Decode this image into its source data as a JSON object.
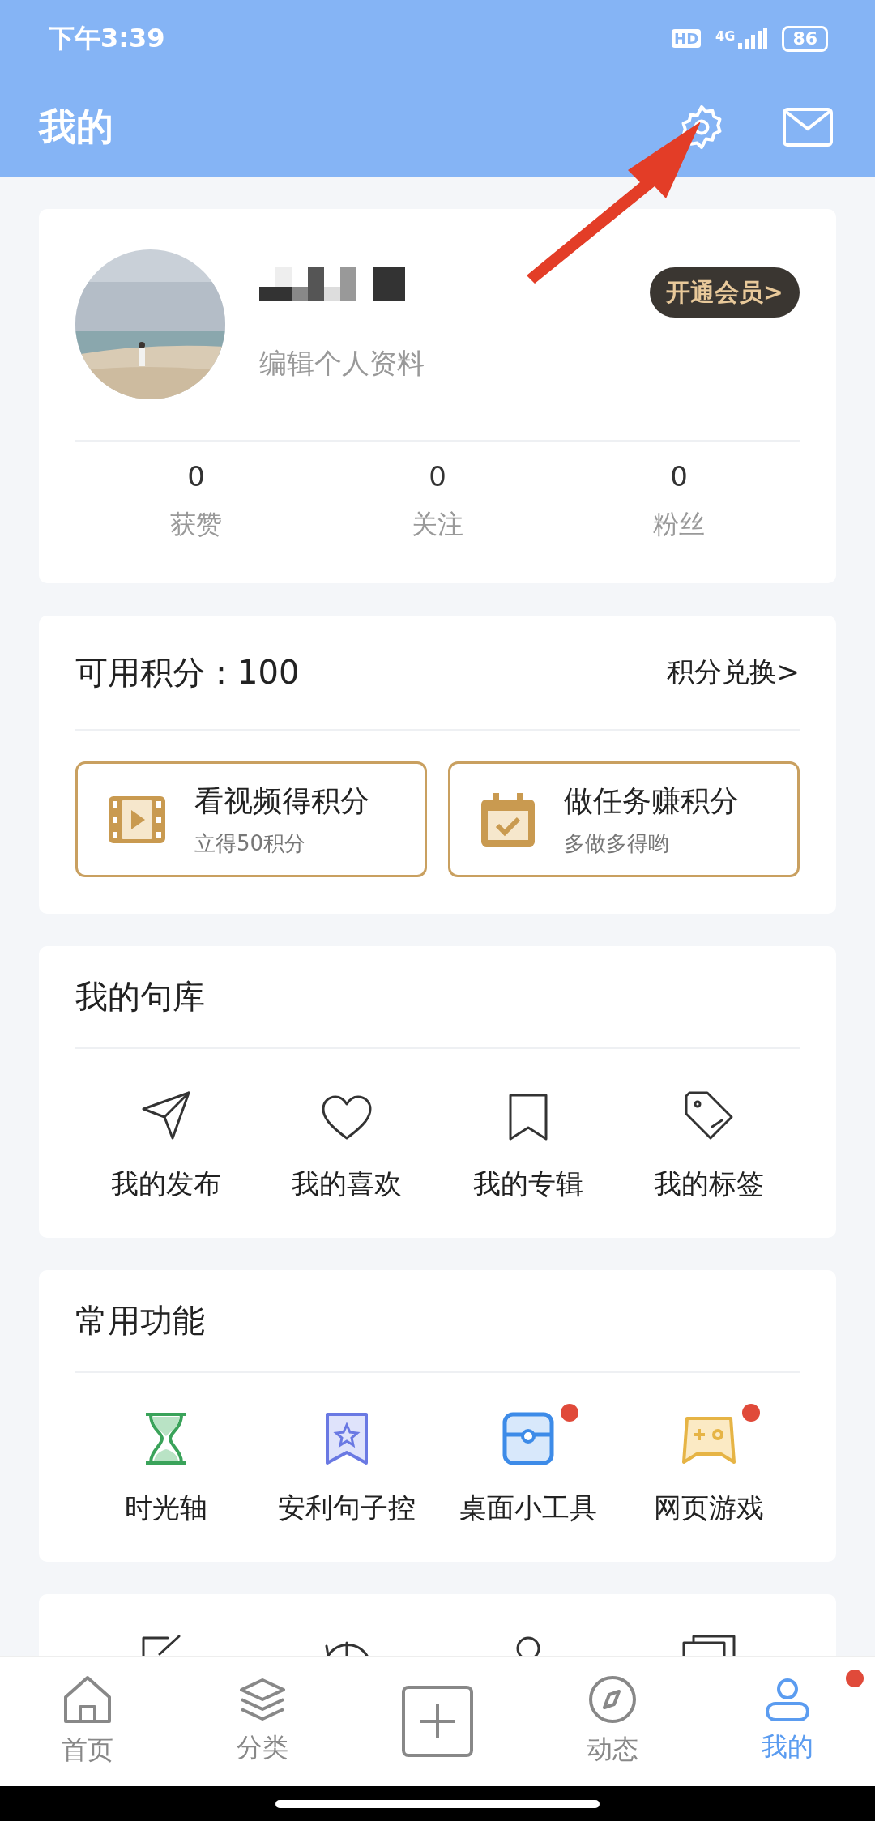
{
  "status_bar": {
    "time": "下午3:39",
    "hd": "HD",
    "network": "4G",
    "battery": "86"
  },
  "header": {
    "title": "我的"
  },
  "profile": {
    "edit_link": "编辑个人资料",
    "vip_button": "开通会员>",
    "stats": [
      {
        "value": "0",
        "label": "获赞"
      },
      {
        "value": "0",
        "label": "关注"
      },
      {
        "value": "0",
        "label": "粉丝"
      }
    ]
  },
  "points": {
    "title": "可用积分：100",
    "exchange_link": "积分兑换>",
    "tasks": [
      {
        "title": "看视频得积分",
        "subtitle": "立得50积分"
      },
      {
        "title": "做任务赚积分",
        "subtitle": "多做多得哟"
      }
    ]
  },
  "library": {
    "title": "我的句库",
    "items": [
      {
        "label": "我的发布",
        "badge": false
      },
      {
        "label": "我的喜欢",
        "badge": false
      },
      {
        "label": "我的专辑",
        "badge": false
      },
      {
        "label": "我的标签",
        "badge": false
      }
    ]
  },
  "tools": {
    "title": "常用功能",
    "items": [
      {
        "label": "时光轴",
        "badge": false
      },
      {
        "label": "安利句子控",
        "badge": false
      },
      {
        "label": "桌面小工具",
        "badge": true
      },
      {
        "label": "网页游戏",
        "badge": true
      }
    ]
  },
  "bottom_nav": [
    {
      "kind": "tab",
      "label": "首页",
      "selected": false,
      "badge": false
    },
    {
      "kind": "tab",
      "label": "分类",
      "selected": false,
      "badge": false
    },
    {
      "kind": "add"
    },
    {
      "kind": "tab",
      "label": "动态",
      "selected": false,
      "badge": false
    },
    {
      "kind": "tab",
      "label": "我的",
      "selected": true,
      "badge": true
    }
  ]
}
